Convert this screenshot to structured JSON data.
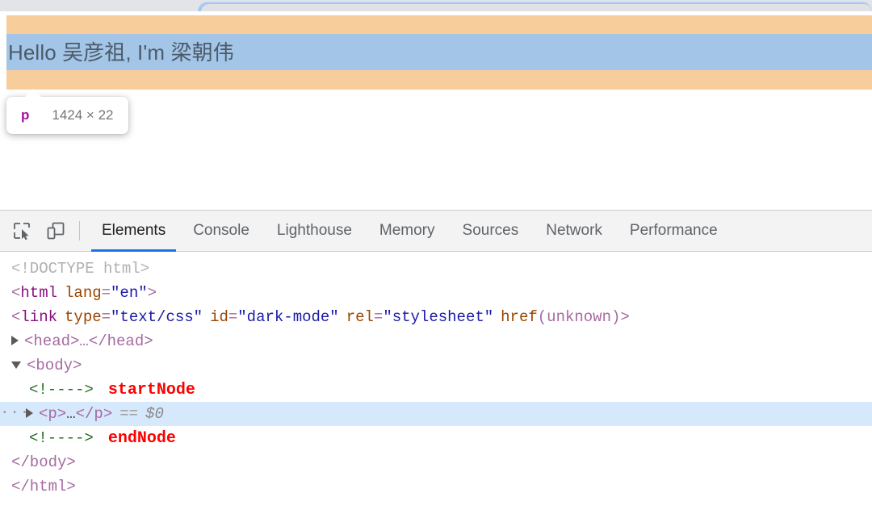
{
  "browser_chrome": {
    "omnibox_visible": true
  },
  "page": {
    "highlighted_text": "Hello 吴彦祖, I'm 梁朝伟",
    "overlay": {
      "padding_color": "#f8cd9c",
      "content_color": "#a3c6e8",
      "text_color": "#4c5a68"
    },
    "tooltip": {
      "tag_name": "p",
      "dimensions": "1424 × 22"
    }
  },
  "devtools": {
    "toolbar": {
      "inspect_icon": "inspect-element-icon",
      "device_icon": "device-toolbar-icon"
    },
    "tabs": [
      {
        "label": "Elements",
        "active": true
      },
      {
        "label": "Console",
        "active": false
      },
      {
        "label": "Lighthouse",
        "active": false
      },
      {
        "label": "Memory",
        "active": false
      },
      {
        "label": "Sources",
        "active": false
      },
      {
        "label": "Network",
        "active": false
      },
      {
        "label": "Performance",
        "active": false
      }
    ],
    "accent_color": "#1a73e8",
    "selection_color": "#d6e9fc",
    "tree": {
      "doctype": "<!DOCTYPE html>",
      "html_open_lt": "<",
      "html_tag": "html",
      "html_attr_name": "lang",
      "html_attr_eq": "=",
      "html_attr_val": "\"en\"",
      "html_open_gt": ">",
      "link_lt": "<",
      "link_tag": "link",
      "link_attr1_name": "type",
      "link_attr1_val": "\"text/css\"",
      "link_attr2_name": "id",
      "link_attr2_val": "\"dark-mode\"",
      "link_attr3_name": "rel",
      "link_attr3_val": "\"stylesheet\"",
      "link_attr4_name": "href",
      "link_attr4_val": "(unknown)",
      "link_gt": ">",
      "head_collapsed": "<head>…</head>",
      "body_open": "<body>",
      "comment_start": "<!---->",
      "annotation_start": "startNode",
      "p_collapsed_open": "<p>",
      "p_collapsed_dots": "…",
      "p_collapsed_close": "</p>",
      "p_eq": "==",
      "p_dollar": "$0",
      "row_overflow_badge": "···",
      "comment_end": "<!---->",
      "annotation_end": "endNode",
      "body_close": "</body>",
      "html_close": "</html>"
    }
  }
}
